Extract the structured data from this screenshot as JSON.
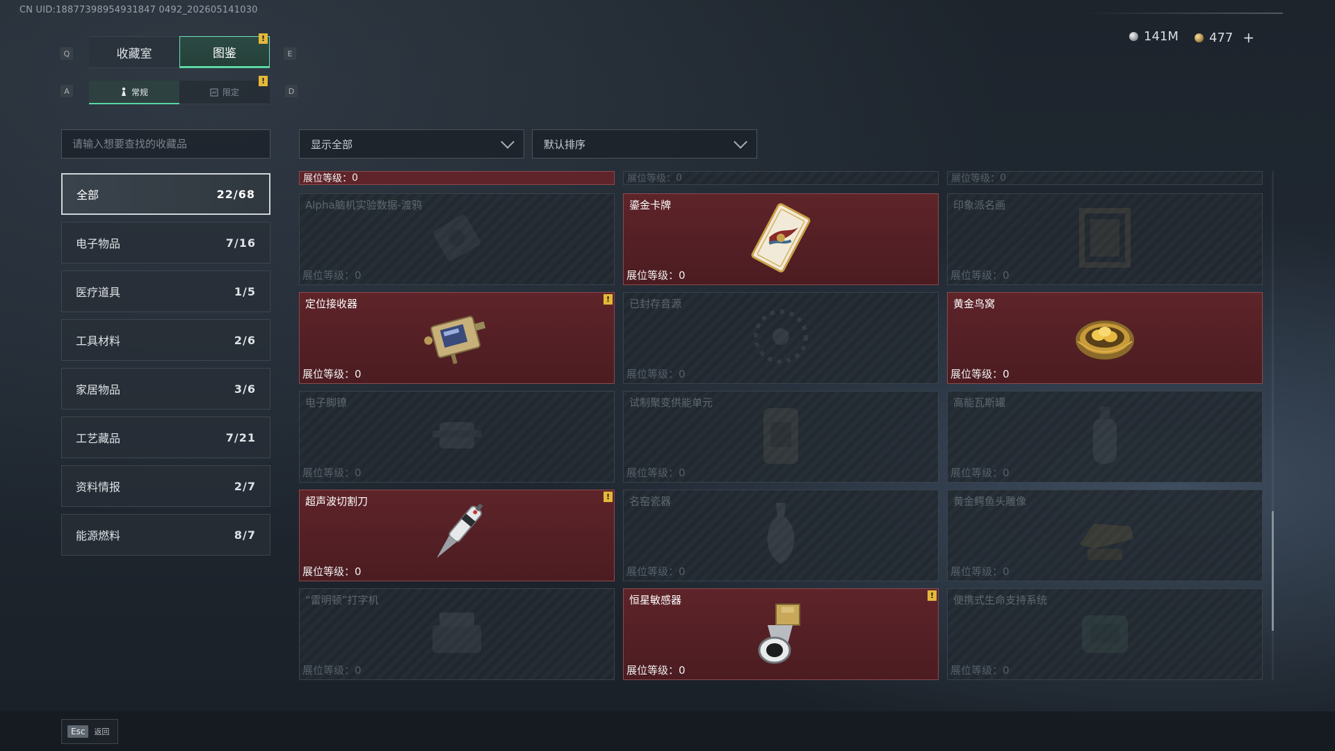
{
  "uid": "CN UID:18877398954931847 0492_202605141030",
  "currency": {
    "silver": "141M",
    "gold": "477",
    "add": "+"
  },
  "keys": {
    "prev_tab": "Q",
    "next_tab": "E",
    "prev_sub": "A",
    "next_sub": "D",
    "back": "Esc"
  },
  "tabs": [
    {
      "label": "收藏室"
    },
    {
      "label": "图鉴"
    }
  ],
  "subtabs": [
    {
      "label": "常规"
    },
    {
      "label": "限定"
    }
  ],
  "search": {
    "placeholder": "请输入想要查找的收藏品"
  },
  "filters": {
    "show": "显示全部",
    "sort": "默认排序"
  },
  "categories": [
    {
      "label": "全部",
      "count": "22/68"
    },
    {
      "label": "电子物品",
      "count": "7/16"
    },
    {
      "label": "医疗道具",
      "count": "1/5"
    },
    {
      "label": "工具材料",
      "count": "2/6"
    },
    {
      "label": "家居物品",
      "count": "3/6"
    },
    {
      "label": "工艺藏品",
      "count": "7/21"
    },
    {
      "label": "资料情报",
      "count": "2/7"
    },
    {
      "label": "能源燃料",
      "count": "8/7"
    }
  ],
  "level_prefix": "展位等级：",
  "partial_row": [
    {
      "level": "0",
      "owned": true
    },
    {
      "level": "0",
      "owned": false
    },
    {
      "level": "0",
      "owned": false
    }
  ],
  "items": [
    {
      "name": "Alpha脑机实验数据-渡鸦",
      "level": "0",
      "owned": false,
      "icon": "data-drive-icon",
      "alert": false
    },
    {
      "name": "鎏金卡牌",
      "level": "0",
      "owned": true,
      "icon": "gilded-card-icon",
      "alert": false
    },
    {
      "name": "印象派名画",
      "level": "0",
      "owned": false,
      "icon": "painting-icon",
      "alert": false
    },
    {
      "name": "定位接收器",
      "level": "0",
      "owned": true,
      "icon": "receiver-icon",
      "alert": true
    },
    {
      "name": "已封存音源",
      "level": "0",
      "owned": false,
      "icon": "sound-source-icon",
      "alert": false
    },
    {
      "name": "黄金鸟窝",
      "level": "0",
      "owned": true,
      "icon": "golden-nest-icon",
      "alert": false
    },
    {
      "name": "电子脚镣",
      "level": "0",
      "owned": false,
      "icon": "ankle-monitor-icon",
      "alert": false
    },
    {
      "name": "试制聚变供能单元",
      "level": "0",
      "owned": false,
      "icon": "fusion-unit-icon",
      "alert": false
    },
    {
      "name": "高能瓦斯罐",
      "level": "0",
      "owned": false,
      "icon": "gas-canister-icon",
      "alert": false
    },
    {
      "name": "超声波切割刀",
      "level": "0",
      "owned": true,
      "icon": "ultrasonic-cutter-icon",
      "alert": true
    },
    {
      "name": "名窑瓷器",
      "level": "0",
      "owned": false,
      "icon": "porcelain-vase-icon",
      "alert": false
    },
    {
      "name": "黄金鳄鱼头雕像",
      "level": "0",
      "owned": false,
      "icon": "crocodile-statue-icon",
      "alert": false
    },
    {
      "name": "“雷明顿”打字机",
      "level": "0",
      "owned": false,
      "icon": "typewriter-icon",
      "alert": false
    },
    {
      "name": "恒星敏感器",
      "level": "0",
      "owned": true,
      "icon": "star-sensor-icon",
      "alert": true
    },
    {
      "name": "便携式生命支持系统",
      "level": "0",
      "owned": false,
      "icon": "life-support-icon",
      "alert": false
    }
  ],
  "footer": {
    "back_label": "返回"
  },
  "colors": {
    "accent": "#5ad7a4",
    "owned_bg": "#5e2429",
    "alert": "#e5b83a"
  }
}
